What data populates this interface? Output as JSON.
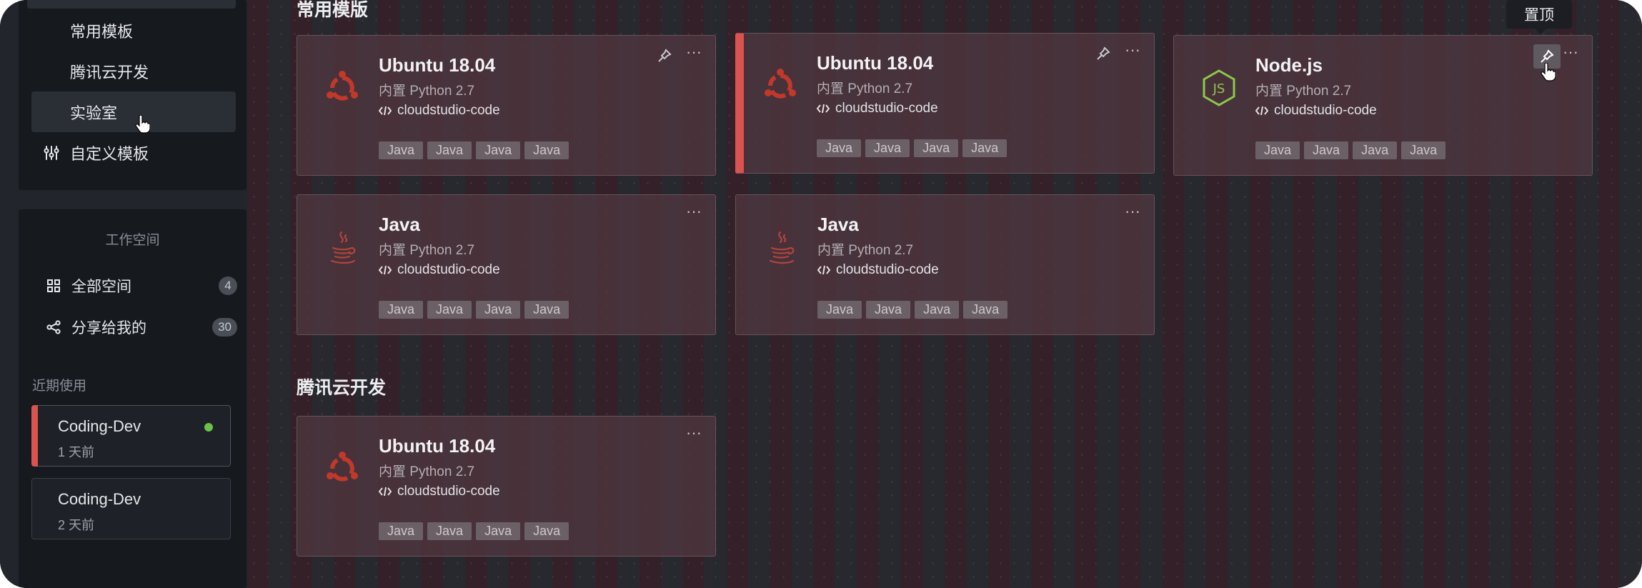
{
  "sidebar": {
    "template_nav": [
      {
        "label": "常用模板",
        "active": false
      },
      {
        "label": "腾讯云开发",
        "active": false
      },
      {
        "label": "实验室",
        "active": true
      },
      {
        "label": "自定义模板",
        "active": false,
        "icon": "sliders-icon"
      }
    ],
    "workspace": {
      "title": "工作空间",
      "items": [
        {
          "label": "全部空间",
          "icon": "grid-icon",
          "count": "4"
        },
        {
          "label": "分享给我的",
          "icon": "share-icon",
          "count": "30"
        }
      ],
      "recent_label": "近期使用",
      "recent": [
        {
          "name": "Coding-Dev",
          "time": "1 天前",
          "status": "online"
        },
        {
          "name": "Coding-Dev",
          "time": "2 天前"
        }
      ]
    }
  },
  "main": {
    "sections": [
      {
        "title": "常用模版",
        "cards": [
          {
            "title": "Ubuntu 18.04",
            "subtitle": "内置 Python 2.7",
            "repo": "cloudstudio-code",
            "tags": [
              "Java",
              "Java",
              "Java",
              "Java"
            ],
            "logo": "ubuntu-logo-icon"
          },
          {
            "title": "Ubuntu 18.04",
            "subtitle": "内置 Python 2.7",
            "repo": "cloudstudio-code",
            "tags": [
              "Java",
              "Java",
              "Java",
              "Java"
            ],
            "logo": "ubuntu-logo-icon",
            "highlighted": true
          },
          {
            "title": "Node.js",
            "subtitle": "内置 Python 2.7",
            "repo": "cloudstudio-code",
            "tags": [
              "Java",
              "Java",
              "Java",
              "Java"
            ],
            "logo": "nodejs-logo-icon",
            "pin_hovered": true
          },
          {
            "title": "Java",
            "subtitle": "内置 Python 2.7",
            "repo": "cloudstudio-code",
            "tags": [
              "Java",
              "Java",
              "Java",
              "Java"
            ],
            "logo": "java-logo-icon"
          },
          {
            "title": "Java",
            "subtitle": "内置 Python 2.7",
            "repo": "cloudstudio-code",
            "tags": [
              "Java",
              "Java",
              "Java",
              "Java"
            ],
            "logo": "java-logo-icon"
          }
        ]
      },
      {
        "title": "腾讯云开发",
        "cards": [
          {
            "title": "Ubuntu 18.04",
            "subtitle": "内置 Python 2.7",
            "repo": "cloudstudio-code",
            "tags": [
              "Java",
              "Java",
              "Java",
              "Java"
            ],
            "logo": "ubuntu-logo-icon"
          }
        ]
      }
    ],
    "tooltip": "置顶",
    "more_label": "···"
  },
  "colors": {
    "accent_red": "#d9534f",
    "online_green": "#6bc04b",
    "ubuntu_logo": "#c0392b",
    "nodejs_logo": "#8cc84b",
    "java_logo": "#b0463c"
  }
}
